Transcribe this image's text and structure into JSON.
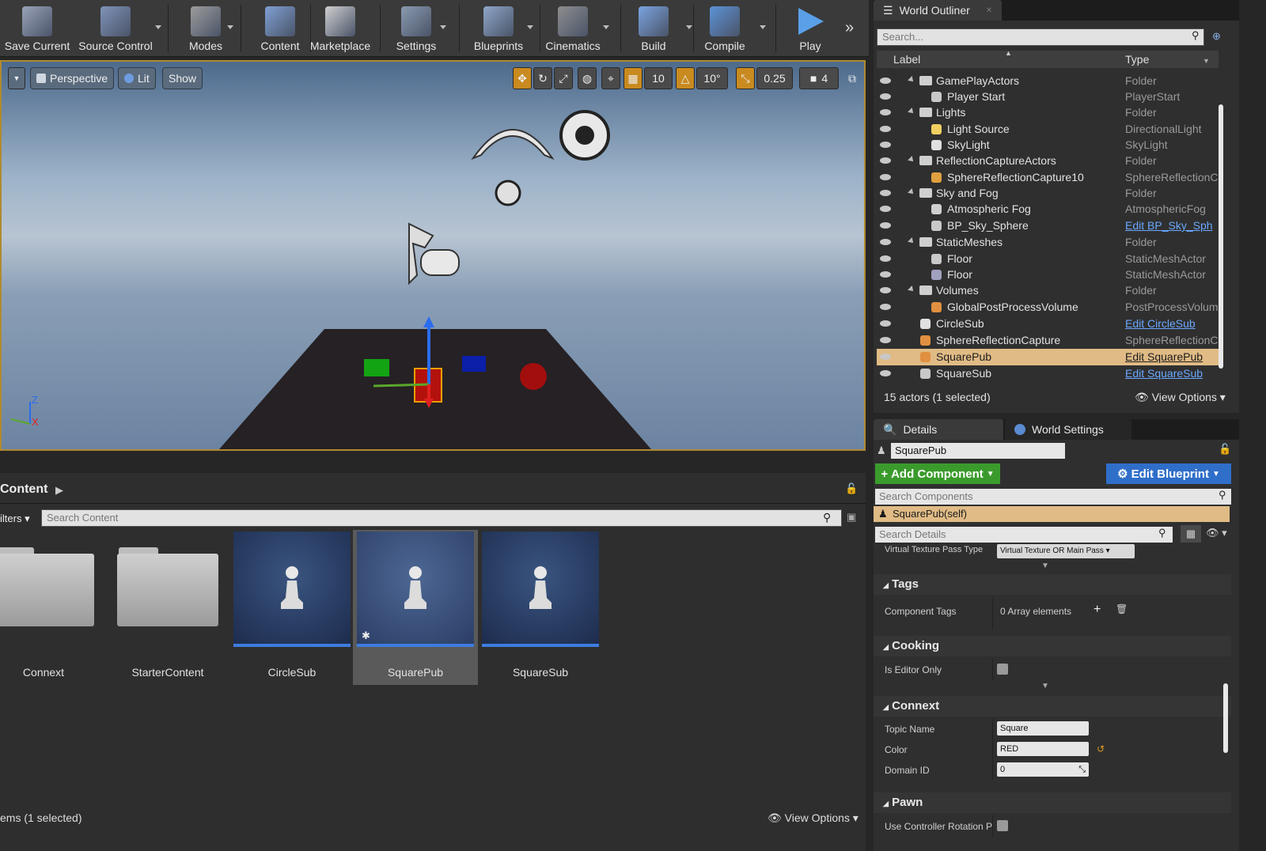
{
  "toolbar": {
    "buttons": [
      {
        "label": "Save Current",
        "icon": "save-icon"
      },
      {
        "label": "Source Control",
        "icon": "source-control-icon"
      },
      {
        "label": "Modes",
        "icon": "modes-icon"
      },
      {
        "label": "Content",
        "icon": "content-icon"
      },
      {
        "label": "Marketplace",
        "icon": "marketplace-icon"
      },
      {
        "label": "Settings",
        "icon": "settings-icon"
      },
      {
        "label": "Blueprints",
        "icon": "blueprints-icon"
      },
      {
        "label": "Cinematics",
        "icon": "cinematics-icon"
      },
      {
        "label": "Build",
        "icon": "build-icon"
      },
      {
        "label": "Compile",
        "icon": "compile-icon"
      },
      {
        "label": "Play",
        "icon": "play-icon"
      }
    ]
  },
  "viewport": {
    "perspective": "Perspective",
    "lit": "Lit",
    "show": "Show",
    "grid_snap": "10",
    "rot_snap": "10°",
    "scale_snap": "0.25",
    "cam_speed": "4",
    "axis_z": "Z",
    "axis_x": "X"
  },
  "content_browser": {
    "title": "Content",
    "filters": "ilters",
    "search_placeholder": "Search Content",
    "status": "ems (1 selected)",
    "view_options": "View Options",
    "assets": [
      {
        "name": "Connext",
        "kind": "folder"
      },
      {
        "name": "StarterContent",
        "kind": "folder"
      },
      {
        "name": "CircleSub",
        "kind": "blueprint"
      },
      {
        "name": "SquarePub",
        "kind": "blueprint",
        "selected": true
      },
      {
        "name": "SquareSub",
        "kind": "blueprint"
      }
    ]
  },
  "outliner": {
    "tab": "World Outliner",
    "search_placeholder": "Search...",
    "col_label": "Label",
    "col_type": "Type",
    "rows": [
      {
        "label": "GamePlayActors",
        "type": "Folder",
        "depth": 1,
        "folder": true
      },
      {
        "label": "Player Start",
        "type": "PlayerStart",
        "depth": 2
      },
      {
        "label": "Lights",
        "type": "Folder",
        "depth": 1,
        "folder": true
      },
      {
        "label": "Light Source",
        "type": "DirectionalLight",
        "depth": 2
      },
      {
        "label": "SkyLight",
        "type": "SkyLight",
        "depth": 2
      },
      {
        "label": "ReflectionCaptureActors",
        "type": "Folder",
        "depth": 1,
        "folder": true
      },
      {
        "label": "SphereReflectionCapture10",
        "type": "SphereReflectionCa",
        "depth": 2
      },
      {
        "label": "Sky and Fog",
        "type": "Folder",
        "depth": 1,
        "folder": true
      },
      {
        "label": "Atmospheric Fog",
        "type": "AtmosphericFog",
        "depth": 2
      },
      {
        "label": "BP_Sky_Sphere",
        "type": "Edit BP_Sky_Sph",
        "depth": 2,
        "link": true
      },
      {
        "label": "StaticMeshes",
        "type": "Folder",
        "depth": 1,
        "folder": true
      },
      {
        "label": "Floor",
        "type": "StaticMeshActor",
        "depth": 2
      },
      {
        "label": "Floor",
        "type": "StaticMeshActor",
        "depth": 2
      },
      {
        "label": "Volumes",
        "type": "Folder",
        "depth": 1,
        "folder": true
      },
      {
        "label": "GlobalPostProcessVolume",
        "type": "PostProcessVolum",
        "depth": 2
      },
      {
        "label": "CircleSub",
        "type": "Edit CircleSub",
        "depth": 1,
        "link": true
      },
      {
        "label": "SphereReflectionCapture",
        "type": "SphereReflectionCa",
        "depth": 1
      },
      {
        "label": "SquarePub",
        "type": "Edit SquarePub",
        "depth": 1,
        "link": true,
        "selected": true
      },
      {
        "label": "SquareSub",
        "type": "Edit SquareSub",
        "depth": 1,
        "link": true
      }
    ],
    "status": "15 actors (1 selected)",
    "view_options": "View Options"
  },
  "details": {
    "tab_details": "Details",
    "tab_world_settings": "World Settings",
    "actor_name": "SquarePub",
    "add_component": "Add Component",
    "edit_blueprint": "Edit Blueprint",
    "search_components": "Search Components",
    "self_component": "SquarePub(self)",
    "search_details": "Search Details",
    "vt_label": "Virtual Texture Pass Type",
    "vt_value": "Virtual Texture OR Main Pass",
    "cat_tags": "Tags",
    "component_tags_label": "Component Tags",
    "component_tags_value": "0 Array elements",
    "cat_cooking": "Cooking",
    "editor_only_label": "Is Editor Only",
    "cat_connext": "Connext",
    "topic_name_label": "Topic Name",
    "topic_name_value": "Square",
    "color_label": "Color",
    "color_value": "RED",
    "domain_id_label": "Domain ID",
    "domain_id_value": "0",
    "cat_pawn": "Pawn",
    "use_controller_label": "Use Controller Rotation Pitc"
  },
  "colors": {
    "selection": "#e0bb85",
    "accent_orange": "#c98a1f",
    "add_component_green": "#3a9b2c",
    "edit_blueprint_blue": "#2f6ec9",
    "link_blue": "#6aa8ff"
  }
}
